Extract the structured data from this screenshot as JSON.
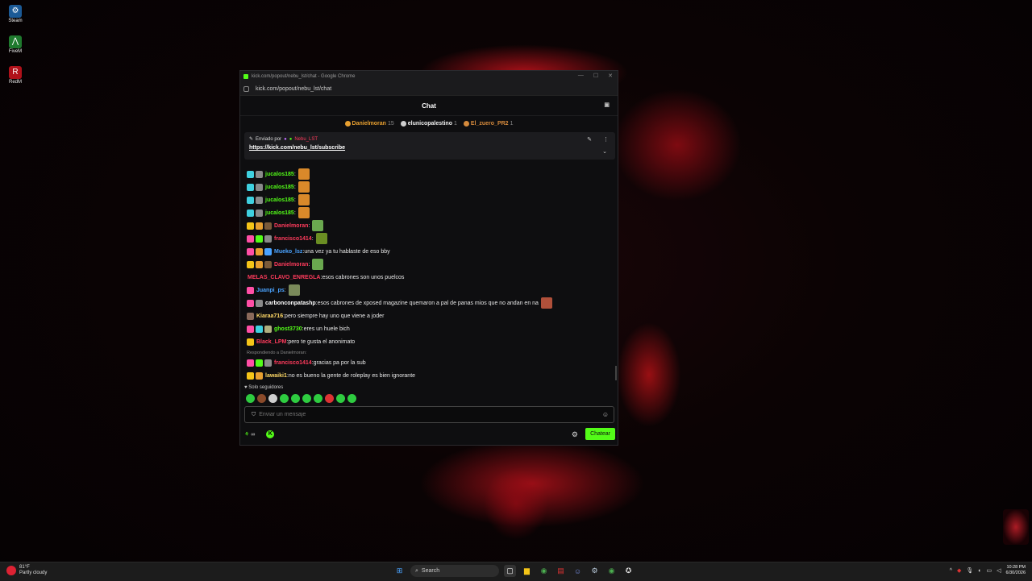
{
  "desktop": {
    "icons": [
      {
        "label": "Steam",
        "icon": "steam-icon",
        "color": "#1b5a96"
      },
      {
        "label": "FiveM",
        "icon": "fivem-icon",
        "color": "#1f7a2e"
      },
      {
        "label": "RedM",
        "icon": "redm-icon",
        "color": "#b0111a"
      }
    ]
  },
  "window": {
    "title": "kick.com/popout/nebu_lst/chat - Google Chrome",
    "controls": {
      "minimize": "—",
      "maximize": "☐",
      "close": "✕"
    },
    "url": "kick.com/popout/nebu_lst/chat"
  },
  "chat": {
    "header_title": "Chat",
    "gifters": [
      {
        "name": "Danielmoran",
        "count": "15",
        "color": "#e8a030"
      },
      {
        "name": "elunicopalestino",
        "count": "1",
        "color": "#cfcfcf"
      },
      {
        "name": "El_zuero_PR2",
        "count": "1",
        "color": "#d68a3c"
      }
    ],
    "pinned": {
      "label": "Enviado por",
      "sender": "Nebu_LST",
      "link": "https://kick.com/nebu_lst/subscribe"
    },
    "messages": [
      {
        "user": "jucalos185",
        "color": "#53fc18",
        "text": "",
        "badges": [
          "#3fd1e0",
          "#8a8a8a"
        ],
        "emote": "#d9892a"
      },
      {
        "user": "jucalos185",
        "color": "#53fc18",
        "text": "",
        "badges": [
          "#3fd1e0",
          "#8a8a8a"
        ],
        "emote": "#d9892a"
      },
      {
        "user": "jucalos185",
        "color": "#53fc18",
        "text": "",
        "badges": [
          "#3fd1e0",
          "#8a8a8a"
        ],
        "emote": "#d9892a"
      },
      {
        "user": "jucalos185",
        "color": "#53fc18",
        "text": "",
        "badges": [
          "#3fd1e0",
          "#8a8a8a"
        ],
        "emote": "#d9892a"
      },
      {
        "user": "Danielmoran",
        "color": "#ff3b5c",
        "text": "",
        "badges": [
          "#f5c518",
          "#e8a030",
          "#7a5a3a"
        ],
        "emote": "#6aa84f"
      },
      {
        "user": "francisco1414",
        "color": "#ff3b5c",
        "text": "",
        "badges": [
          "#ff4fa6",
          "#53fc18",
          "#8a8a8a"
        ],
        "emote": "#6b8e23"
      },
      {
        "user": "Mueko_lsz",
        "color": "#4aa3ff",
        "text": "una vez ya tu hablaste de eso bby",
        "badges": [
          "#ff4fa6",
          "#e8a030",
          "#4aa3ff"
        ],
        "emote": ""
      },
      {
        "user": "Danielmoran",
        "color": "#ff3b5c",
        "text": "",
        "badges": [
          "#f5c518",
          "#e8a030",
          "#7a5a3a"
        ],
        "emote": "#6aa84f"
      },
      {
        "user": "MELAS_CLAVO_ENREGLA",
        "color": "#ff3b5c",
        "text": "esos cabrones son unos puelcos",
        "badges": [],
        "emote": ""
      },
      {
        "user": "Juanpi_ps",
        "color": "#4aa3ff",
        "text": "",
        "badges": [
          "#ff4fa6"
        ],
        "emote": "#7a8a5a"
      },
      {
        "user": "carbonconpatashp",
        "color": "#ffffff",
        "text": "esos cabrones de xposed magazine quemaron a pal de panas mios que no andan en na",
        "badges": [
          "#ff4fa6",
          "#8a8a8a"
        ],
        "emote": "#b0503a"
      },
      {
        "user": "Kiaraa716",
        "color": "#ffd966",
        "text": "pero siempre hay uno que viene a joder",
        "badges": [
          "#8a6a5a"
        ],
        "emote": ""
      },
      {
        "user": "ghost3730",
        "color": "#53fc18",
        "text": "eres un huele bich",
        "badges": [
          "#ff4fa6",
          "#3fd1e0",
          "#b0b080"
        ],
        "emote": ""
      },
      {
        "user": "Black_LPM",
        "color": "#ff3b5c",
        "text": "pero te gusta el anonimato",
        "badges": [
          "#f5c518"
        ],
        "emote": ""
      },
      {
        "user": "francisco1414",
        "color": "#ff3b5c",
        "text": "gracias pa por la sub",
        "badges": [
          "#ff4fa6",
          "#53fc18",
          "#8a8a8a"
        ],
        "emote": "",
        "reply_to": "Respondiendo a Danielmoran:"
      },
      {
        "user": "lawaiki1",
        "color": "#ffd966",
        "text": "no es bueno la gente de roleplay es bien ignorante",
        "badges": [
          "#f5c518",
          "#e8a030"
        ],
        "emote": ""
      }
    ],
    "followers_only": "Solo seguidores",
    "quick_emotes": [
      "#2ecc40",
      "#8a4a2a",
      "#cfcfcf",
      "#2ecc40",
      "#2ecc40",
      "#2ecc40",
      "#2ecc40",
      "#d33",
      "#2ecc40",
      "#2ecc40"
    ],
    "input_placeholder": "Enviar un mensaje",
    "points": "∞",
    "send_label": "Chatear"
  },
  "taskbar": {
    "weather_temp": "81°F",
    "weather_desc": "Partly cloudy",
    "search_label": "Search",
    "time": "10:28 PM",
    "date": "6/30/2026"
  }
}
